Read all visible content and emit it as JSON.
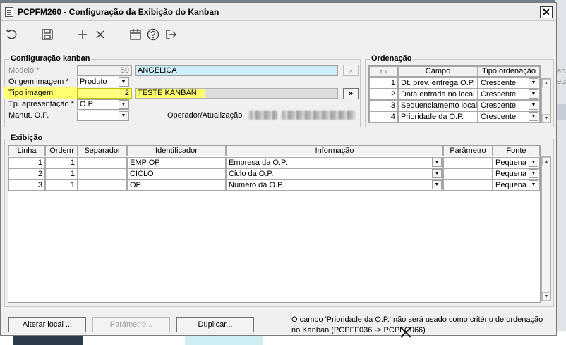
{
  "window": {
    "title": "PCPFM260 - Configuração da Exibição do Kanban",
    "close_label": "✕"
  },
  "toolbar": {
    "items": [
      {
        "name": "undo-icon",
        "glyph": "↺"
      },
      {
        "name": "save-icon",
        "glyph": ""
      },
      {
        "name": "add-icon",
        "glyph": "+"
      },
      {
        "name": "delete-icon",
        "glyph": "×"
      },
      {
        "name": "calendar-icon",
        "glyph": ""
      },
      {
        "name": "help-icon",
        "glyph": "?"
      },
      {
        "name": "exit-icon",
        "glyph": ""
      }
    ]
  },
  "config": {
    "legend": "Configuração kanban",
    "modelo": {
      "label": "Modelo *",
      "code": "50",
      "desc": "ANGELICA"
    },
    "origem": {
      "label": "Origem imagem *",
      "value": "Produto"
    },
    "tipo": {
      "label": "Tipo imagem",
      "code": "2",
      "desc": "TESTE KANBAN",
      "button": "»"
    },
    "tp_apresentacao": {
      "label": "Tp. apresentação *",
      "value": "O.P."
    },
    "manut": {
      "label": "Manut. O.P.",
      "value": ""
    },
    "operador_label": "Operador/Atualização"
  },
  "ordenacao": {
    "legend": "Ordenação",
    "headers": {
      "sort": "↑ ↓",
      "campo": "Campo",
      "tipo": "Tipo ordenação"
    },
    "rows": [
      {
        "n": "1",
        "campo": "Dt. prev. entrega O.P.",
        "tipo": "Crescente"
      },
      {
        "n": "2",
        "campo": "Data entrada no local",
        "tipo": "Crescente"
      },
      {
        "n": "3",
        "campo": "Sequenciamento local",
        "tipo": "Crescente"
      },
      {
        "n": "4",
        "campo": "Prioridade da O.P.",
        "tipo": "Crescente"
      }
    ]
  },
  "exibicao": {
    "legend": "Exibição",
    "headers": {
      "linha": "Linha",
      "ordem": "Ordem",
      "separador": "Separador",
      "identificador": "Identificador",
      "informacao": "Informação",
      "parametro": "Parâmetro",
      "fonte": "Fonte"
    },
    "rows": [
      {
        "linha": "1",
        "ordem": "1",
        "separador": "",
        "identificador": "EMP OP",
        "informacao": "Empresa da O.P.",
        "parametro": "",
        "fonte": "Pequena"
      },
      {
        "linha": "2",
        "ordem": "1",
        "separador": "",
        "identificador": "CICLO",
        "informacao": "Ciclo da O.P.",
        "parametro": "",
        "fonte": "Pequena"
      },
      {
        "linha": "3",
        "ordem": "1",
        "separador": "",
        "identificador": "OP",
        "informacao": "Número da O.P.",
        "parametro": "",
        "fonte": "Pequena"
      }
    ]
  },
  "footer": {
    "alterar_local": "Alterar local ...",
    "parametro": "Parâmetro...",
    "duplicar": "Duplicar...",
    "message": "O campo 'Prioridade da O.P.' não será usado como critério de ordenação no Kanban (PCPFF036 -> PCPFC066)"
  },
  "background": {
    "right_text_1": "erv",
    "right_text_2": "eca"
  }
}
